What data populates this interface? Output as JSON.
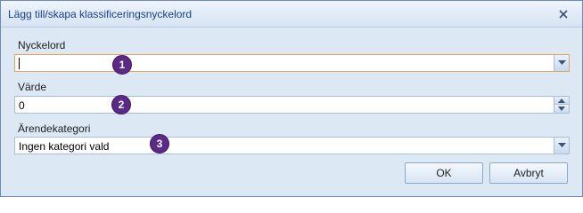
{
  "window": {
    "title": "Lägg till/skapa klassificeringsnyckelord"
  },
  "fields": [
    {
      "label": "Nyckelord",
      "value": "",
      "control": "combobox",
      "badge": "1"
    },
    {
      "label": "Värde",
      "value": "0",
      "control": "spinner",
      "badge": "2"
    },
    {
      "label": "Ärendekategori",
      "value": "Ingen kategori vald",
      "control": "dropdown",
      "badge": "3"
    }
  ],
  "buttons": {
    "ok_label": "OK",
    "cancel_label": "Avbryt"
  },
  "icons": {
    "close": "close-icon",
    "dropdown": "chevron-down-icon",
    "spin_up": "triangle-up-icon",
    "spin_down": "triangle-down-icon"
  },
  "colors": {
    "title_text": "#15428b",
    "badge": "#5b2a86",
    "focus_border": "#e8a35b",
    "dialog_bg": "#dde8f5"
  }
}
